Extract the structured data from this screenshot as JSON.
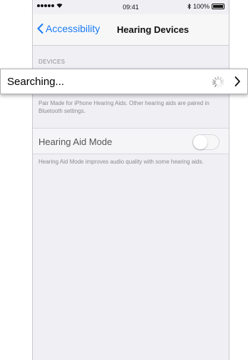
{
  "status_bar": {
    "time": "09:41",
    "battery_text": "100%",
    "wifi_icon": "wifi-icon",
    "bluetooth_icon": "bluetooth-icon"
  },
  "nav": {
    "back_label": "Accessibility",
    "title": "Hearing Devices",
    "accent_color": "#1a7cf5"
  },
  "devices_section": {
    "header": "DEVICES",
    "searching_label": "Searching...",
    "footer": "Pair Made for iPhone Hearing Aids. Other hearing aids are paired in Bluetooth settings."
  },
  "hearing_aid_mode": {
    "label": "Hearing Aid Mode",
    "enabled": false,
    "footer": "Hearing Aid Mode improves audio quality with some hearing aids."
  }
}
